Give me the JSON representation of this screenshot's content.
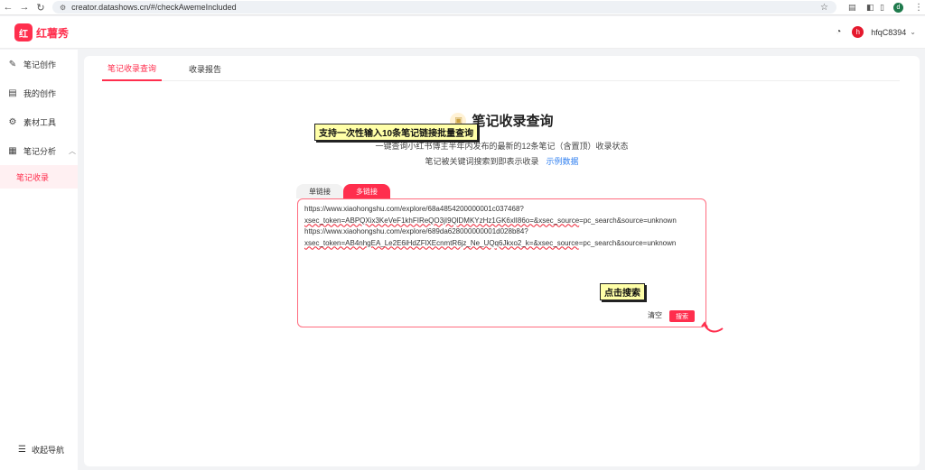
{
  "browser": {
    "url": "creator.datashows.cn/#/checkAwemeIncluded",
    "profile_initial": "d"
  },
  "header": {
    "logo_mark": "红",
    "logo_text": "红薯秀",
    "avatar_initial": "h",
    "username": "hfqC8394"
  },
  "sidebar": {
    "items": [
      {
        "label": "笔记创作",
        "icon": "pen-icon"
      },
      {
        "label": "我的创作",
        "icon": "document-icon"
      },
      {
        "label": "素材工具",
        "icon": "gear-icon"
      },
      {
        "label": "笔记分析",
        "icon": "chart-icon"
      }
    ],
    "sub_item": "笔记收录",
    "collapse_label": "收起导航"
  },
  "tabs": [
    "笔记收录查询",
    "收录报告"
  ],
  "page": {
    "title": "笔记收录查询",
    "desc1": "一键查询小红书博主半年内发布的最新的12条笔记（含置顶）收录状态",
    "desc2": "笔记被关键词搜索到即表示收录",
    "example_link": "示例数据"
  },
  "mode_tabs": [
    "单链接",
    "多链接"
  ],
  "links": [
    {
      "prefix": "https://www.xiaohongshu.com/explore/68a4854200000001c037468?",
      "underlined": ""
    },
    {
      "prefix": "",
      "underlined": "xsec_token=ABPQXix3KeVeF1khFIReQO3jI9QlDMKYzHz1GK6xlI86o=&xsec_source",
      "suffix": "=pc_search&source=unknown"
    },
    {
      "prefix": "https://www.xiaohongshu.com/explore/689da628000000001d028b84?",
      "underlined": ""
    },
    {
      "prefix": "",
      "underlined": "xsec_token=AB4nhgEA_Le2E6iHdZFlXEcnmtR6jz_Ne_UQq6Jkxo2_k=&xsec_source",
      "suffix": "=pc_search&source=unknown"
    }
  ],
  "buttons": {
    "clear": "清空",
    "search": "搜索"
  },
  "callouts": {
    "batch": "支持一次性输入10条笔记链接批量查询",
    "click_search": "点击搜索"
  },
  "colors": {
    "brand": "#ff2e4d",
    "link": "#2f7ff0",
    "callout_bg": "#ffffa8"
  }
}
